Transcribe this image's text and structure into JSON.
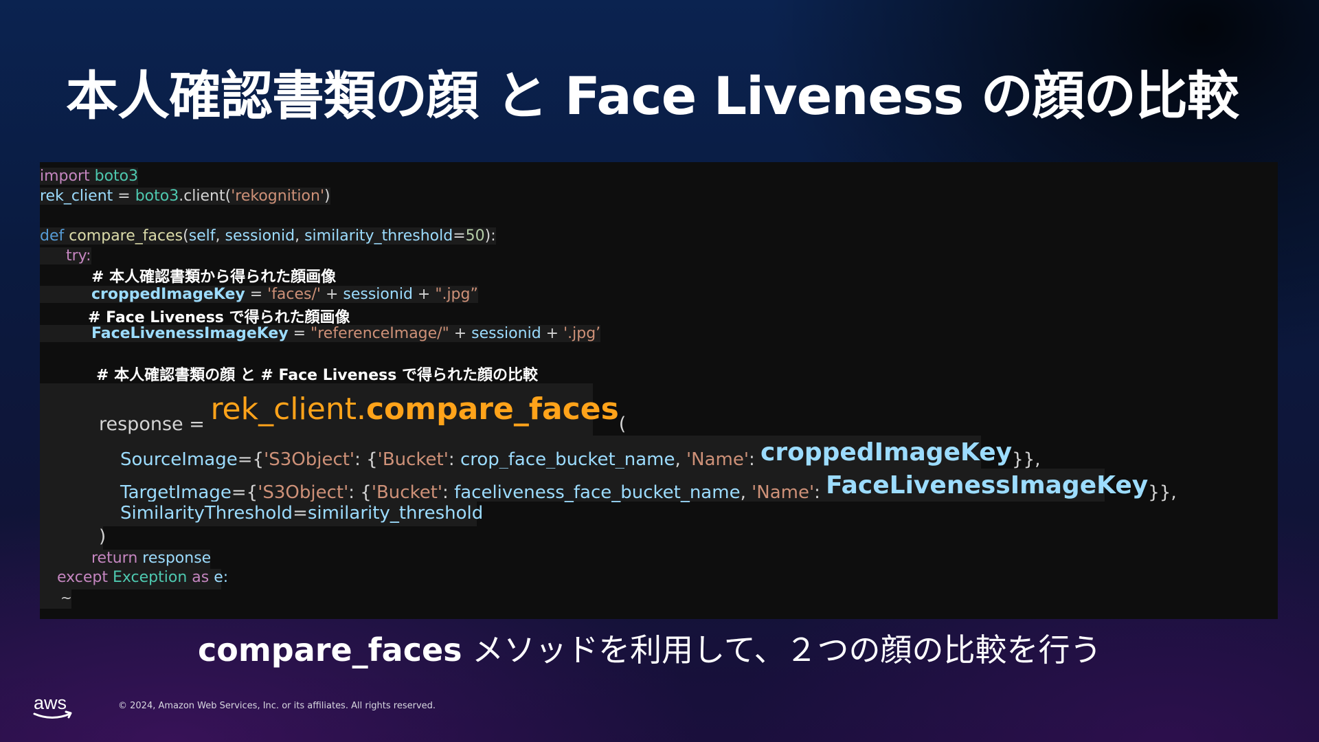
{
  "slide": {
    "title": "本人確認書類の顔 と Face Liveness の顔の比較",
    "subtitle_bold": "compare_faces",
    "subtitle_rest": " メソッドを利用して、２つの顔の比較を行う",
    "copyright": "© 2024, Amazon Web Services, Inc. or its affiliates. All rights reserved.",
    "logo_text": "aws"
  },
  "code": {
    "l1": {
      "import": "import",
      "module": " boto3"
    },
    "l2": {
      "var": "rek_client",
      "eq": " = ",
      "module": "boto3",
      "call": ".client(",
      "str": "'rekognition'",
      "close": ")"
    },
    "l3": {
      "def": "def",
      "fname": " compare_faces",
      "open": "(",
      "self": "self",
      "c1": ", ",
      "sid": "sessionid",
      "c2": ", ",
      "st": "similarity_threshold",
      "eq": "=",
      "num": "50",
      "close": "):"
    },
    "l4": {
      "try": "try:"
    },
    "l5": {
      "comment": "# 本人確認書類から得られた顔画像"
    },
    "l6": {
      "var": "croppedImageKey",
      "eq": " = ",
      "str1": "'faces/'",
      "plus1": " + ",
      "sid": "sessionid",
      "plus2": " + ",
      "str2": "\".jpg”"
    },
    "l7": {
      "comment": "# Face Liveness で得られた顔画像"
    },
    "l8": {
      "var": "FaceLivenessImageKey",
      "eq": " = ",
      "str1": "\"referenceImage/\"",
      "plus1": " + ",
      "sid": "sessionid",
      "plus2": " + ",
      "str2": "'.jpg’"
    },
    "l9": {
      "comment": "# 本人確認書類の顔 と # Face Liveness で得られた顔の比較"
    },
    "l10": {
      "var": "response",
      "eq": " = ",
      "obj": "rek_client.",
      "method": "compare_faces",
      "open": "("
    },
    "l11": {
      "param": "SourceImage",
      "eq": "={",
      "s3": "'S3Object'",
      "c1": ": {",
      "bucket": "'Bucket'",
      "c2": ": ",
      "bname": "crop_face_bucket_name",
      "c3": ", ",
      "name": "'Name'",
      "c4": ": ",
      "key": "croppedImageKey",
      "close": "}},"
    },
    "l12": {
      "param": "TargetImage",
      "eq": "={",
      "s3": "'S3Object'",
      "c1": ": {",
      "bucket": "'Bucket'",
      "c2": ": ",
      "bname": "faceliveness_face_bucket_name",
      "c3": ", ",
      "name": "'Name'",
      "c4": ": ",
      "key": "FaceLivenessImageKey",
      "close": "}},"
    },
    "l13": {
      "param": "SimilarityThreshold",
      "eq": "=",
      "val": "similarity_threshold"
    },
    "l14": {
      "close": ")"
    },
    "l15": {
      "ret": "return",
      "val": " response"
    },
    "l16": {
      "except": "except",
      "cls": " Exception",
      "as": " as",
      "e": " e:"
    },
    "l17": {
      "tilde": "~"
    }
  }
}
